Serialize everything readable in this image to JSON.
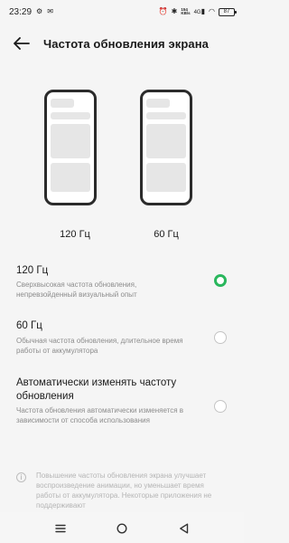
{
  "status_bar": {
    "time": "23:29",
    "network_speed_top": "154",
    "network_speed_bottom": "KB/s",
    "signal_label": "4G",
    "battery": "87"
  },
  "header": {
    "title": "Частота обновления экрана"
  },
  "previews": {
    "label_120": "120 Гц",
    "label_60": "60 Гц"
  },
  "options": [
    {
      "title": "120 Гц",
      "description": "Сверхвысокая частота обновления, непревзойденный визуальный опыт",
      "selected": true
    },
    {
      "title": "60 Гц",
      "description": "Обычная частота обновления, длительное время работы от аккумулятора",
      "selected": false
    },
    {
      "title": "Автоматически изменять частоту обновления",
      "description": "Частота обновления автоматически изменяется в зависимости от способа использования",
      "selected": false
    }
  ],
  "info": {
    "text": "Повышение частоты обновления экрана улучшает воспроизведение анимации, но уменьшает время работы от аккумулятора. Некоторые приложения не поддерживают"
  },
  "colors": {
    "accent": "#2ab75d",
    "background": "#f5f5f5",
    "secondary_text": "#8c8c8c"
  }
}
